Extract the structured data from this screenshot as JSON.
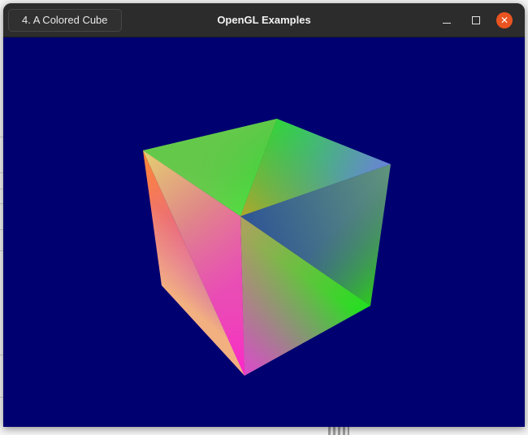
{
  "window": {
    "title": "OpenGL Examples",
    "example_button_label": "4. A Colored Cube"
  },
  "controls": {
    "minimize_icon": "minimize-icon",
    "maximize_icon": "maximize-icon",
    "close_icon": "close-icon"
  },
  "colors": {
    "titlebar": "#2c2c2c",
    "viewport_background": "#000070",
    "close_button": "#e95420"
  },
  "scene": {
    "object": "colored-cube"
  }
}
